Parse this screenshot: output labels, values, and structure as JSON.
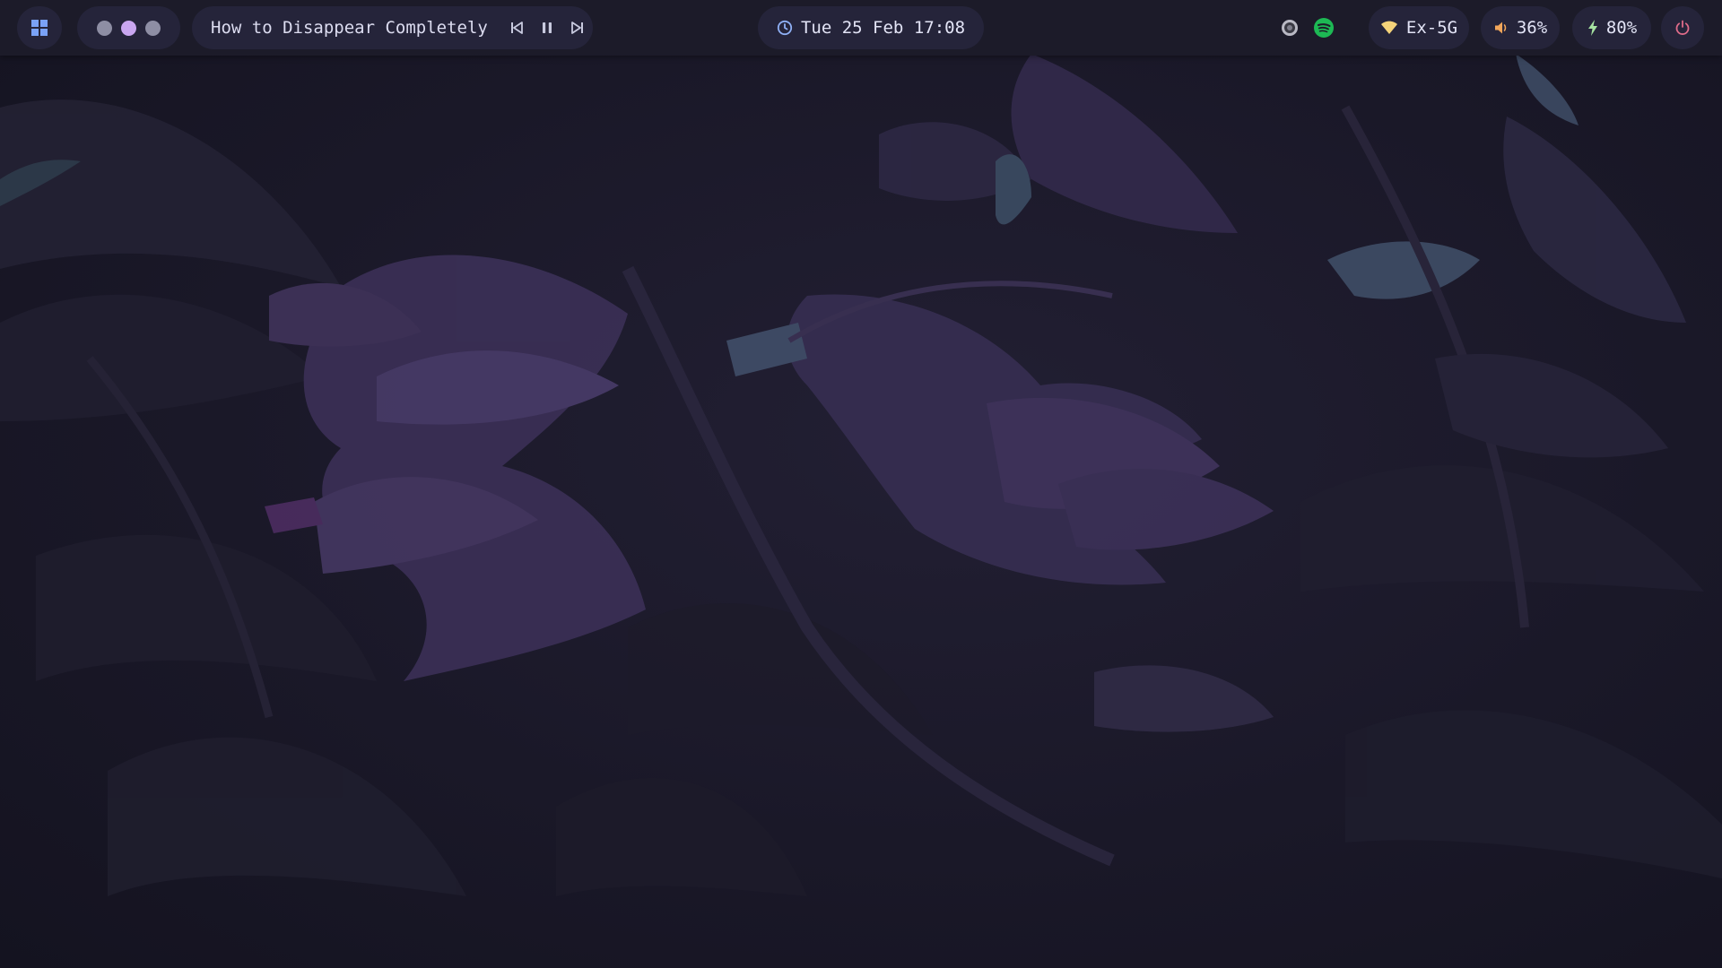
{
  "colors": {
    "bar_bg": "#1c1b29",
    "module_bg": "#25243a",
    "text": "#d7d9ef",
    "accent_purple": "#c9a6f0",
    "launcher_blue": "#7aa2f7",
    "spotify_green": "#1db954",
    "wifi_yellow": "#f5d37a",
    "power_red": "#e06c8a"
  },
  "launcher": {
    "icon": "windows-grid-icon"
  },
  "workspaces": [
    {
      "index": 1,
      "active": false
    },
    {
      "index": 2,
      "active": true
    },
    {
      "index": 3,
      "active": false
    }
  ],
  "media": {
    "title": "How to Disappear Completely",
    "controls": [
      "previous-icon",
      "pause-icon",
      "next-icon"
    ]
  },
  "clock": {
    "icon": "clock-icon",
    "text": "Tue 25 Feb 17:08"
  },
  "tray": {
    "items": [
      "record-icon",
      "spotify-icon"
    ]
  },
  "network": {
    "icon": "wifi-icon",
    "ssid": "Ex-5G"
  },
  "volume": {
    "icon": "speaker-icon",
    "percent": "36%"
  },
  "battery": {
    "icon": "bolt-icon",
    "percent": "80%"
  },
  "power": {
    "icon": "power-icon"
  }
}
